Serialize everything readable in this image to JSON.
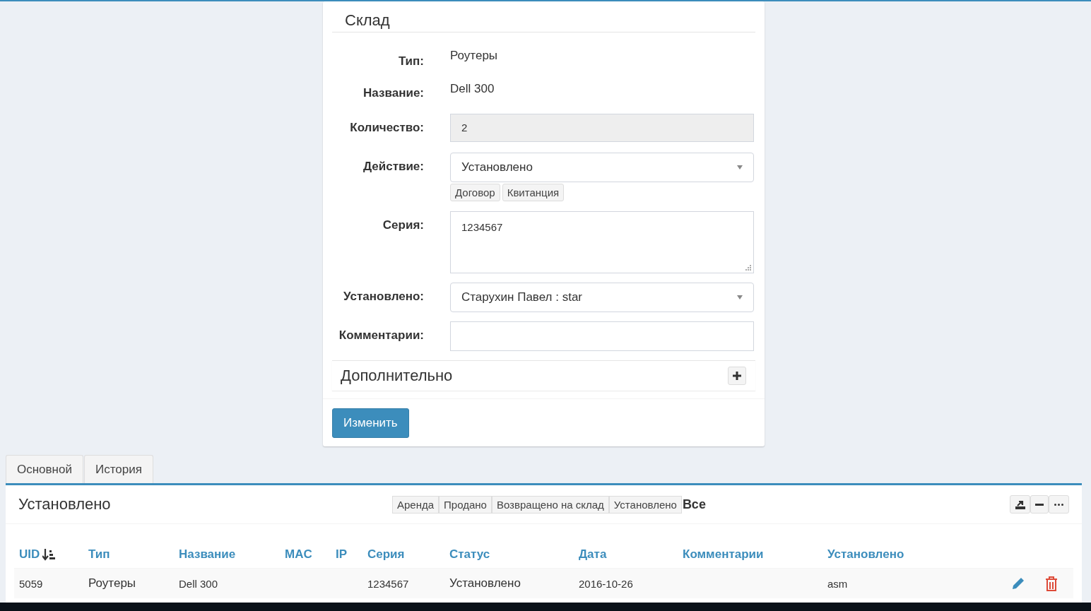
{
  "form": {
    "title": "Склад",
    "fields": [
      {
        "kind": "text",
        "label": "Тип:",
        "value": "Роутеры"
      },
      {
        "kind": "text",
        "label": "Название:",
        "value": "Dell 300"
      },
      {
        "kind": "readonly",
        "label": "Количество:",
        "value": "2"
      },
      {
        "kind": "select",
        "label": "Действие:",
        "value": "Установлено",
        "buttons": [
          "Договор",
          "Квитанция"
        ]
      },
      {
        "kind": "textarea",
        "label": "Серия:",
        "value": "1234567"
      },
      {
        "kind": "select",
        "label": "Установлено:",
        "value": "Старухин Павел : star"
      },
      {
        "kind": "input",
        "label": "Комментарии:"
      }
    ],
    "extra": {
      "title": "Дополнительно",
      "expanded": false
    },
    "submit": "Изменить"
  },
  "tabs": [
    {
      "label": "Основной"
    },
    {
      "label": "История"
    }
  ],
  "table_box": {
    "title": "Установлено",
    "filters": [
      {
        "label": "Аренда",
        "selected": false
      },
      {
        "label": "Продано",
        "selected": false
      },
      {
        "label": "Возвращено на склад",
        "selected": false
      },
      {
        "label": "Установлено",
        "selected": false
      },
      {
        "label": "Все",
        "selected": true
      }
    ],
    "columns": [
      "UID",
      "Тип",
      "Название",
      "MAC",
      "IP",
      "Серия",
      "Статус",
      "Дата",
      "Комментарии",
      "Установлено"
    ],
    "rows": [
      {
        "cells": [
          "5059",
          "Роутеры",
          "Dell 300",
          "",
          "",
          "1234567",
          "Установлено",
          "2016-10-26",
          "",
          "asm"
        ]
      }
    ]
  }
}
